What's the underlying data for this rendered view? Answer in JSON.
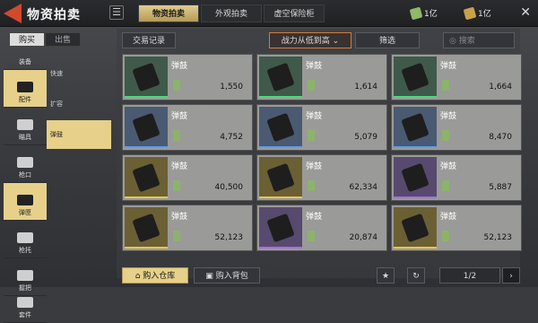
{
  "header": {
    "title": "物资拍卖"
  },
  "tabs": [
    {
      "label": "物资拍卖",
      "active": true
    },
    {
      "label": "外观拍卖",
      "active": false
    },
    {
      "label": "虚空保险柜",
      "active": false
    }
  ],
  "currencies": [
    {
      "icon": "green-ticket-icon",
      "value": "1亿"
    },
    {
      "icon": "gold-ticket-icon",
      "value": "1亿"
    }
  ],
  "left_segment": {
    "buy": "购买",
    "sell": "出售"
  },
  "nav": [
    {
      "label": "装备",
      "icon": "helmet-icon"
    },
    {
      "label": "配件",
      "icon": "attachment-icon",
      "active": true
    },
    {
      "label": "瞄具",
      "icon": "scope-icon"
    },
    {
      "label": "枪口",
      "icon": "muzzle-icon"
    },
    {
      "label": "弹匣",
      "icon": "magazine-icon",
      "active": true
    },
    {
      "label": "枪托",
      "icon": "stock-icon"
    },
    {
      "label": "握把",
      "icon": "grip-icon"
    },
    {
      "label": "套件",
      "icon": "kit-icon"
    }
  ],
  "subcategories": [
    {
      "label": "快速"
    },
    {
      "label": "扩容"
    },
    {
      "label": "弹鼓",
      "active": true
    }
  ],
  "toolbar": {
    "history": "交易记录",
    "sort": "战力从低到高",
    "filter": "筛选",
    "search_placeholder": "搜索"
  },
  "items": [
    {
      "name": "弹鼓",
      "price": "1,550",
      "rarity": "green"
    },
    {
      "name": "弹鼓",
      "price": "1,614",
      "rarity": "green"
    },
    {
      "name": "弹鼓",
      "price": "1,664",
      "rarity": "green"
    },
    {
      "name": "弹鼓",
      "price": "4,752",
      "rarity": "blue"
    },
    {
      "name": "弹鼓",
      "price": "5,079",
      "rarity": "blue"
    },
    {
      "name": "弹鼓",
      "price": "8,470",
      "rarity": "blue"
    },
    {
      "name": "弹鼓",
      "price": "40,500",
      "rarity": "gold"
    },
    {
      "name": "弹鼓",
      "price": "62,334",
      "rarity": "gold"
    },
    {
      "name": "弹鼓",
      "price": "5,887",
      "rarity": "purple"
    },
    {
      "name": "弹鼓",
      "price": "52,123",
      "rarity": "gold"
    },
    {
      "name": "弹鼓",
      "price": "20,874",
      "rarity": "purple"
    },
    {
      "name": "弹鼓",
      "price": "52,123",
      "rarity": "gold"
    }
  ],
  "rarity_colors": {
    "green": "#4bd97a",
    "blue": "#5a9ef0",
    "gold": "#e8c64a",
    "purple": "#a46fe0"
  },
  "bottom": {
    "buy_to_storage": "购入仓库",
    "buy_to_backpack": "购入背包",
    "page": "1/2"
  }
}
